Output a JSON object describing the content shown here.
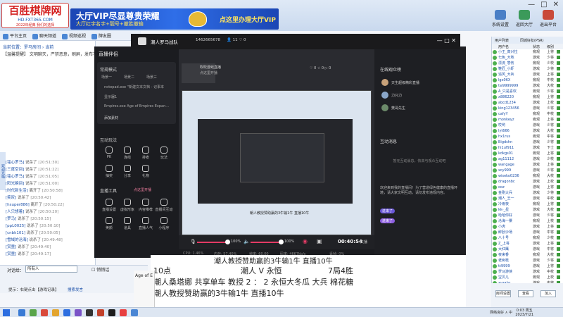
{
  "banner": {
    "logo_line1": "百胜棋牌网",
    "logo_line2": "HD.FXT365.COM",
    "logo_line3": "2022年经典 我们的选择",
    "ad_title": "大厅VIP尽显尊贵荣耀",
    "ad_sub": "大厅红字名字+靓号+撤胜撤输",
    "ad_cta": "点这里办理大厅VIP",
    "window_controls": [
      "—",
      "□",
      "✕"
    ],
    "top_icons": [
      {
        "label": "系统设置",
        "color": "#4a7fc6"
      },
      {
        "label": "返回大厅",
        "color": "#3b9a5a"
      },
      {
        "label": "退出平台",
        "color": "#c94a3a"
      }
    ]
  },
  "toolbar": {
    "items": [
      "平台主页",
      "聊天频道",
      "视频巡视",
      "牌友圈"
    ]
  },
  "left_panel": {
    "header": "当前位置：罗马房间 › 当前",
    "notice": "【温馨提醒】 文明聊天，严禁恶意，刷屏，发布不良信息",
    "rows": [
      {
        "name": "[铭心罗马]",
        "text": "说杀了",
        "time": "[20:51:30]"
      },
      {
        "name": "[三度空间]",
        "text": "说杀了",
        "time": "[20:51:22]"
      },
      {
        "name": "[铭心罗马]",
        "text": "说杀了",
        "time": "[20:51:05]"
      },
      {
        "name": "[阳光瞬间]",
        "text": "说杀了",
        "time": "[20:51:00]"
      },
      {
        "name": "[时代新生活]",
        "text": "离开了",
        "time": "[20:50:58]"
      },
      {
        "name": "[笑叹]",
        "text": "说杀了",
        "time": "[20:50:42]"
      },
      {
        "name": "[hsuper886]",
        "text": "离开了",
        "time": "[20:50:22]"
      },
      {
        "name": "[人只想着]",
        "text": "说杀了",
        "time": "[20:50:20]"
      },
      {
        "name": "[罗马]",
        "text": "说杀了",
        "time": "[20:50:15]"
      },
      {
        "name": "[ppL0025]",
        "text": "说杀了",
        "time": "[20:50:10]"
      },
      {
        "name": "[cnbk101]",
        "text": "说杀了",
        "time": "[20:50:05]"
      },
      {
        "name": "[雪域的沧海]",
        "text": "说杀了",
        "time": "[20:49:48]"
      },
      {
        "name": "[赏童]",
        "text": "说杀了",
        "time": "[20:49:40]"
      },
      {
        "name": "[赏童]",
        "text": "说杀了",
        "time": "[20:49:17]"
      }
    ],
    "side_tab": "欢迎光临"
  },
  "chat_bar": {
    "say_label": "对话给：",
    "input_value": "所有人",
    "checkbox_label": "悄悄话",
    "tip": "提示：右键点击【游戏记录】",
    "tip_link": "搜索发言"
  },
  "obs": {
    "title": "直播伴侣",
    "scene_header": "常规模式",
    "scene_tabs": [
      "场景一",
      "场景二",
      "场景三"
    ],
    "add_btn": "添加",
    "sources": [
      "notepad.exe \"新建文本文档 - 记事本",
      "显示器1",
      "Empires.exe Age of Empires Expan..."
    ],
    "add_source": "添加素材",
    "interact_header": "互动玩法",
    "interact_items": [
      "PK",
      "连线",
      "排麦",
      "玩法"
    ],
    "interact_items2": [
      "抽奖",
      "分享",
      "礼物"
    ],
    "tools_header": "直播工具",
    "tools_link": "点这里开播",
    "tools_items": [
      "直播设置",
      "虚拟形象",
      "内容推荐",
      "直播间互动"
    ],
    "tools_items2": [
      "美颜",
      "道具",
      "直播人气",
      "小程序"
    ],
    "room_title": "吹吹游戏直播",
    "room_sub": "点这里开播",
    "counters": "♡ 0   ☆ 0   ▷ 0",
    "preview_caption": "朝人教授赞助赢的3牛输1牛   直播10牛",
    "mic_pct": "100%",
    "spk_pct": "100%",
    "timer": "00:40:54",
    "live_label": "关播",
    "status": [
      "CPU: 1.46%",
      "内存: 57.40%",
      "帧率: 60.00",
      "码率: 4667kb/s",
      "丢帧: 0%"
    ],
    "right_header": "在线观众榜",
    "viewers": [
      "天生超级精彩直播",
      "力只力",
      "樊哥先生"
    ],
    "interact_msgs_header": "互动消息",
    "msg_placeholder": "暂无互动消息，快来与观众互动吧",
    "msg_text": "欢迎来到我的直播间！为了营造绿色健康的直播环境，请大家文明互动，请勿发布违规内容。",
    "tag_label": "进来了"
  },
  "room": {
    "title": "潮人罗马战队",
    "id": "1462665678",
    "people": "11",
    "likes": "0"
  },
  "caption": {
    "top": "潮人教授赞助赢的3牛输1牛   直播10牛",
    "line1_a": "10点",
    "line1_b": "潮人 V 永恒",
    "line1_c": "7局4胜",
    "line2": "潮人桑塔娜  共享单车  教授  2  ：  2 永恒大冬瓜  大兵  棉花糖",
    "line3": "潮人教授赞助赢的3牛输1牛    直播10牛"
  },
  "age_window": {
    "title": "Age of E"
  },
  "right_panel": {
    "tabs": [
      "用户列表",
      "同城好友(PSR)"
    ],
    "cols": [
      "用户名",
      "状态",
      "级别"
    ],
    "users": [
      {
        "name": "小王_高兴拉",
        "st": "旁观",
        "lv": "上将"
      },
      {
        "name": "七色_大地",
        "st": "游戏",
        "lv": "少将"
      },
      {
        "name": "漂流_悲伤",
        "st": "旁观",
        "lv": "少校"
      },
      {
        "name": "鞋匠_小虾",
        "st": "游戏",
        "lv": "少将"
      },
      {
        "name": "追风_大兵",
        "st": "游戏",
        "lv": "上将"
      },
      {
        "name": "lgx06X",
        "st": "旁观",
        "lv": "中校"
      },
      {
        "name": "tw9999999",
        "st": "游戏",
        "lv": "大校"
      },
      {
        "name": "A_只是喜欢",
        "st": "旁观",
        "lv": "少将"
      },
      {
        "name": "x886220",
        "st": "旁观",
        "lv": "上将"
      },
      {
        "name": "abcd1234",
        "st": "游戏",
        "lv": "上校"
      },
      {
        "name": "king123456",
        "st": "游戏",
        "lv": "少将"
      },
      {
        "name": "cafyY",
        "st": "旁观",
        "lv": "中校"
      },
      {
        "name": "monkeyz",
        "st": "旁观",
        "lv": "上将"
      },
      {
        "name": "哎哟",
        "st": "游戏",
        "lv": "少将"
      },
      {
        "name": "lyt666",
        "st": "游戏",
        "lv": "大校"
      },
      {
        "name": "hx1rus",
        "st": "旁观",
        "lv": "中将"
      },
      {
        "name": "Bigdshn",
        "st": "游戏",
        "lv": "少将"
      },
      {
        "name": "hi1uf911",
        "st": "游戏",
        "lv": "下士"
      },
      {
        "name": "kdkgs01",
        "st": "旁观",
        "lv": "上将"
      },
      {
        "name": "ag11112",
        "st": "游戏",
        "lv": "少校"
      },
      {
        "name": "wangage",
        "st": "游戏",
        "lv": "上将"
      },
      {
        "name": "xcy999",
        "st": "游戏",
        "lv": "少将"
      },
      {
        "name": "wiseko0236",
        "st": "旁观",
        "lv": "大校"
      },
      {
        "name": "dragonbc",
        "st": "游戏",
        "lv": "上校"
      },
      {
        "name": "ooz",
        "st": "游戏",
        "lv": "上将"
      },
      {
        "name": "金刚大兵",
        "st": "游戏",
        "lv": "少将"
      },
      {
        "name": "潮人_王一",
        "st": "游戏",
        "lv": "中校"
      },
      {
        "name": "冷雨夜",
        "st": "旁观",
        "lv": "上将"
      },
      {
        "name": "kk-_星",
        "st": "游戏",
        "lv": "大校"
      },
      {
        "name": "哈哈你好",
        "st": "游戏",
        "lv": "少将"
      },
      {
        "name": "沧海一粟",
        "st": "旁观",
        "lv": "上校"
      },
      {
        "name": "小虎",
        "st": "游戏",
        "lv": "上将"
      },
      {
        "name": "醉卧沙场",
        "st": "游戏",
        "lv": "中将"
      },
      {
        "name": "八十号",
        "st": "旁观",
        "lv": "少校"
      },
      {
        "name": "Z_上将",
        "st": "游戏",
        "lv": "上将"
      },
      {
        "name": "大红鹰",
        "st": "游戏",
        "lv": "中将"
      },
      {
        "name": "夜来香",
        "st": "旁观",
        "lv": "大校"
      },
      {
        "name": "老树枝",
        "st": "游戏",
        "lv": "少将"
      },
      {
        "name": "tt9999",
        "st": "游戏",
        "lv": "上将"
      },
      {
        "name": "罗马游侠",
        "st": "游戏",
        "lv": "中校"
      },
      {
        "name": "宝贝儿",
        "st": "旁观",
        "lv": "上校"
      },
      {
        "name": "xyzabc",
        "st": "游戏",
        "lv": "中将"
      },
      {
        "name": "飞虎队长",
        "st": "游戏",
        "lv": "上将"
      },
      {
        "name": "天天向上",
        "st": "旁观",
        "lv": "少将"
      }
    ],
    "buttons": [
      "房间设置",
      "查看",
      "加入"
    ]
  },
  "taskbar": {
    "clock_time": "0:03 周五",
    "clock_date": "2023/7/21",
    "sys": "网络良好 ∧ 中"
  }
}
